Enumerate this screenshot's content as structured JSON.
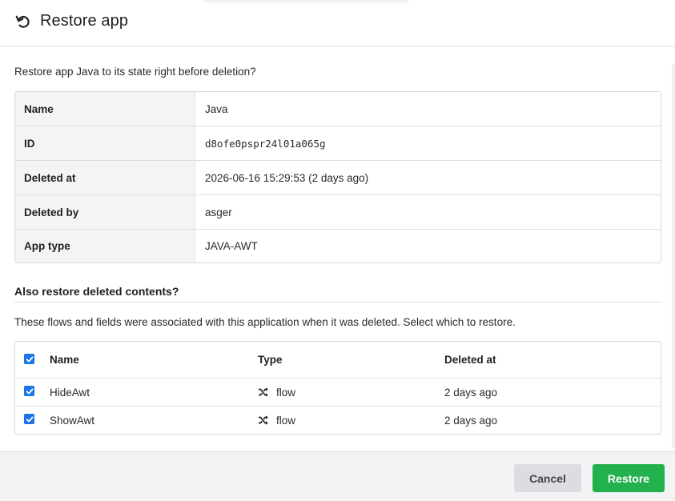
{
  "dialog": {
    "title": "Restore app",
    "intro": "Restore app Java to its state right before deletion?"
  },
  "details": [
    {
      "key": "Name",
      "value": "Java"
    },
    {
      "key": "ID",
      "value": "d8ofe0pspr24l01a065g"
    },
    {
      "key": "Deleted at",
      "value": "2026-06-16 15:29:53 (2 days ago)"
    },
    {
      "key": "Deleted by",
      "value": "asger"
    },
    {
      "key": "App type",
      "value": "JAVA-AWT"
    }
  ],
  "contents": {
    "title": "Also restore deleted contents?",
    "description": "These flows and fields were associated with this application when it was deleted. Select which to restore.",
    "columns": {
      "name": "Name",
      "type": "Type",
      "deleted_at": "Deleted at"
    },
    "select_all_checked": true,
    "rows": [
      {
        "checked": true,
        "name": "HideAwt",
        "type": "flow",
        "type_icon": "shuffle-icon",
        "deleted_at": "2 days ago"
      },
      {
        "checked": true,
        "name": "ShowAwt",
        "type": "flow",
        "type_icon": "shuffle-icon",
        "deleted_at": "2 days ago"
      }
    ]
  },
  "footer": {
    "cancel_label": "Cancel",
    "restore_label": "Restore"
  },
  "colors": {
    "checkbox": "#1a73e8",
    "restore_button": "#22b14c",
    "cancel_button": "#dcdde0"
  }
}
